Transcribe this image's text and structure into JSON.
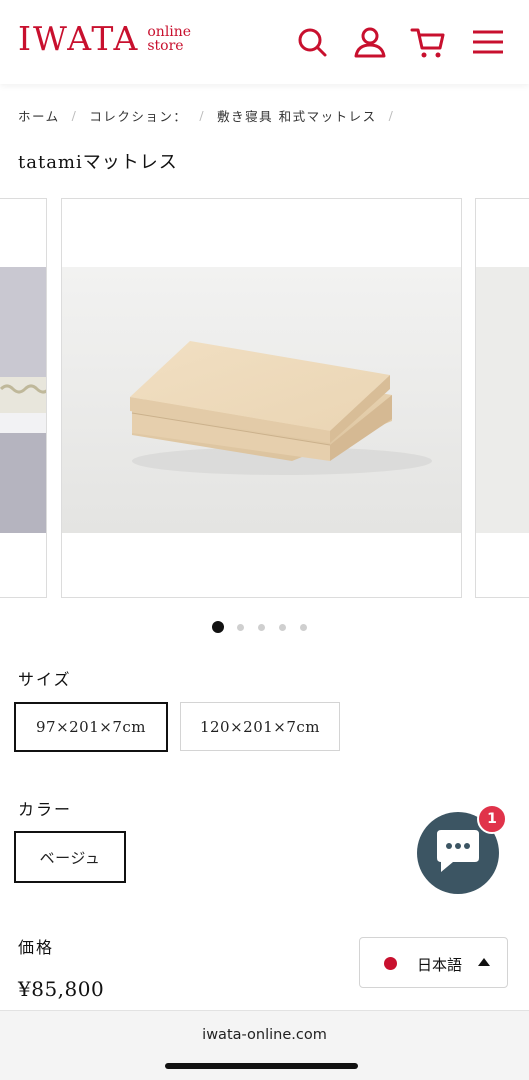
{
  "header": {
    "logo_main": "IWATA",
    "logo_line1": "online",
    "logo_line2": "store",
    "brand_color": "#c8102e",
    "icons": [
      "search-icon",
      "account-icon",
      "cart-icon",
      "menu-icon"
    ]
  },
  "breadcrumb": {
    "items": [
      "ホーム",
      "コレクション：",
      "敷き寝具 和式マットレス"
    ]
  },
  "product": {
    "title": "tatamiマットレス"
  },
  "carousel": {
    "slide_count": 5,
    "active_index": 0
  },
  "options": {
    "size_label": "サイズ",
    "sizes": [
      "97×201×7cm",
      "120×201×7cm"
    ],
    "selected_size": "97×201×7cm",
    "color_label": "カラー",
    "colors": [
      "ベージュ"
    ],
    "selected_color": "ベージュ"
  },
  "price": {
    "label": "価格",
    "value": "¥85,800"
  },
  "chat": {
    "badge_count": "1",
    "color": "#3c5563",
    "badge_color": "#e0334a"
  },
  "language": {
    "current": "日本語"
  },
  "browser": {
    "url": "iwata-online.com"
  }
}
